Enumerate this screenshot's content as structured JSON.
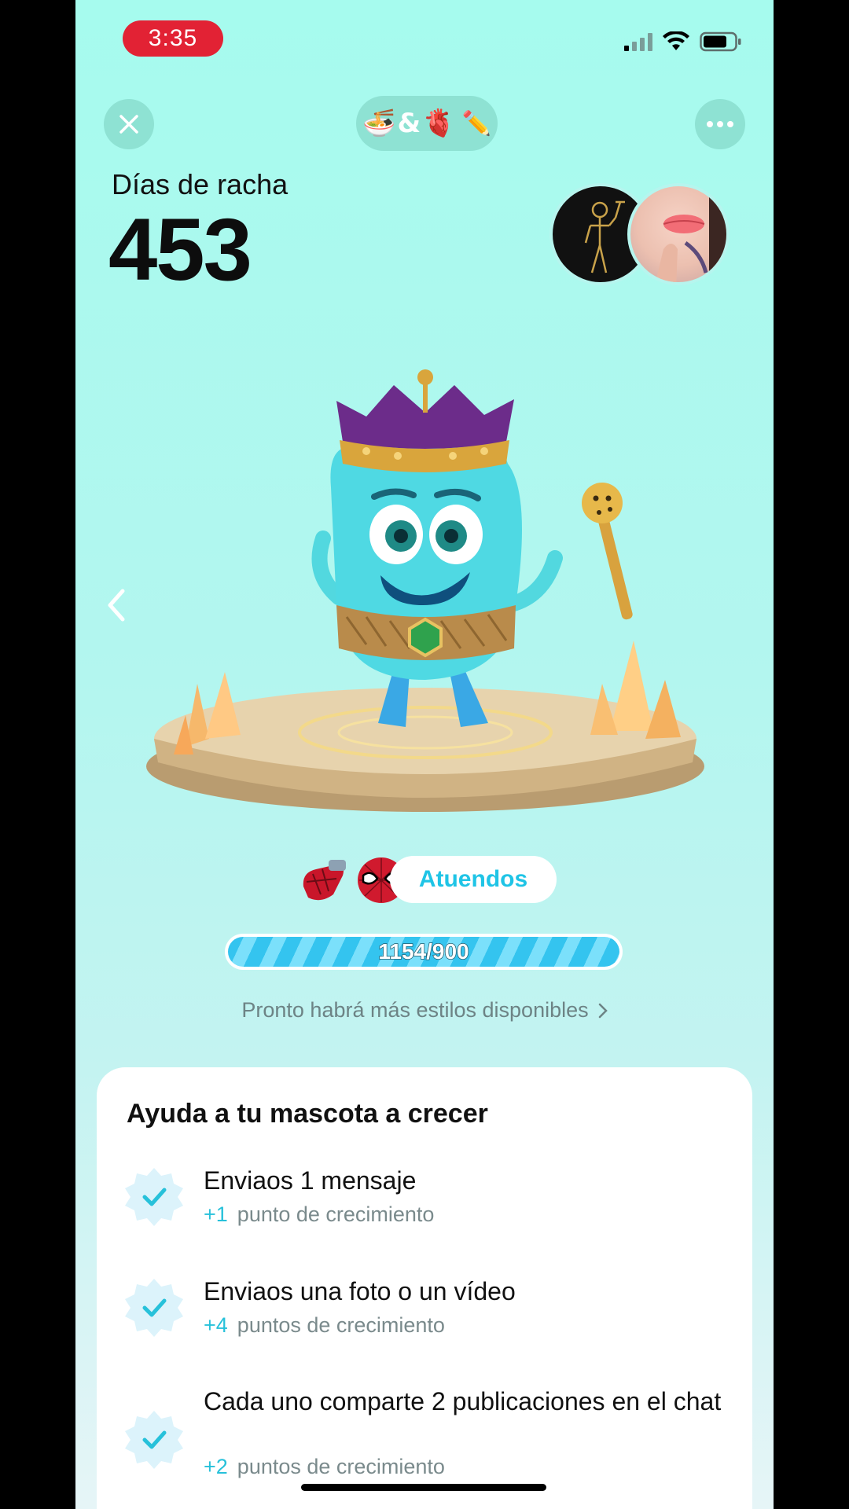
{
  "status_bar": {
    "time": "3:35"
  },
  "header": {
    "close_icon": "close-icon",
    "more_icon": "more-horizontal-icon",
    "pair_emoji": {
      "left": "🍜",
      "amp": "&",
      "right": "🫀",
      "edit": "✏️"
    }
  },
  "streak": {
    "label": "Días de racha",
    "value": "453"
  },
  "outfits": {
    "label": "Atuendos"
  },
  "progress": {
    "text": "1154/900",
    "current": 1154,
    "target": 900,
    "fill_fraction": 1.0
  },
  "more_styles": {
    "label": "Pronto habrá más estilos disponibles"
  },
  "card": {
    "title": "Ayuda a tu mascota a crecer",
    "tasks": [
      {
        "title": "Enviaos 1 mensaje",
        "points": "+1",
        "points_label": "punto de crecimiento"
      },
      {
        "title": "Enviaos una foto o un vídeo",
        "points": "+4",
        "points_label": "puntos de crecimiento"
      },
      {
        "title": "Cada uno comparte 2 publicaciones en el chat",
        "points": "+2",
        "points_label": "puntos de crecimiento"
      }
    ]
  },
  "colors": {
    "accent": "#1fc4e6",
    "bg_top": "#a6fbee",
    "time_pill": "#e22234"
  }
}
